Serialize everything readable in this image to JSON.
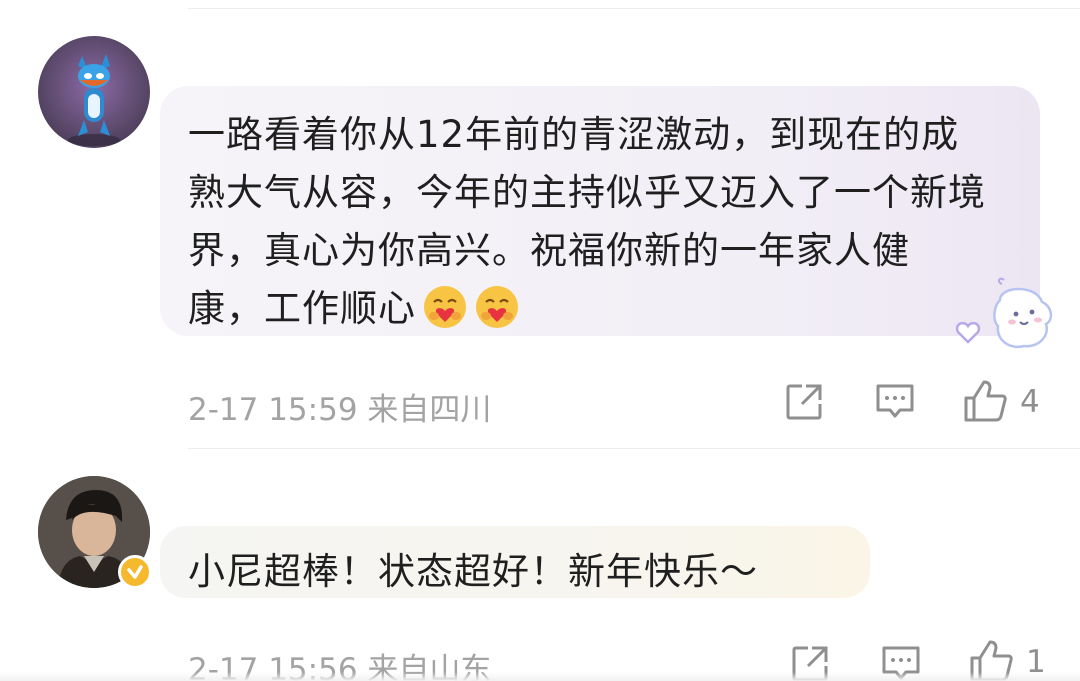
{
  "comments": [
    {
      "text_lines": [
        "一路看着你从12年前的青涩激动，到现在的成",
        "熟大气从容，今年的主持似乎又迈入了一个新境",
        "界，真心为你高兴。祝福你新的一年家人健",
        "康，工作顺心"
      ],
      "emojis": [
        "heart-hug-emoji",
        "heart-hug-emoji"
      ],
      "sticker": "ghost-sticker",
      "timestamp": "2-17 15:59 来自四川",
      "like_count": "4",
      "avatar": "cartoon-creature-avatar"
    },
    {
      "text": "小尼超棒！状态超好！新年快乐～",
      "timestamp": "2-17 15:56 来自山东",
      "like_count": "1",
      "avatar": "young-man-avatar",
      "verified": true
    }
  ],
  "colors": {
    "verified_badge": "#f5b92d",
    "bubble_1": "#f2eef6",
    "bubble_2": "#f7f5ee",
    "meta_text": "#a3a3a3"
  }
}
